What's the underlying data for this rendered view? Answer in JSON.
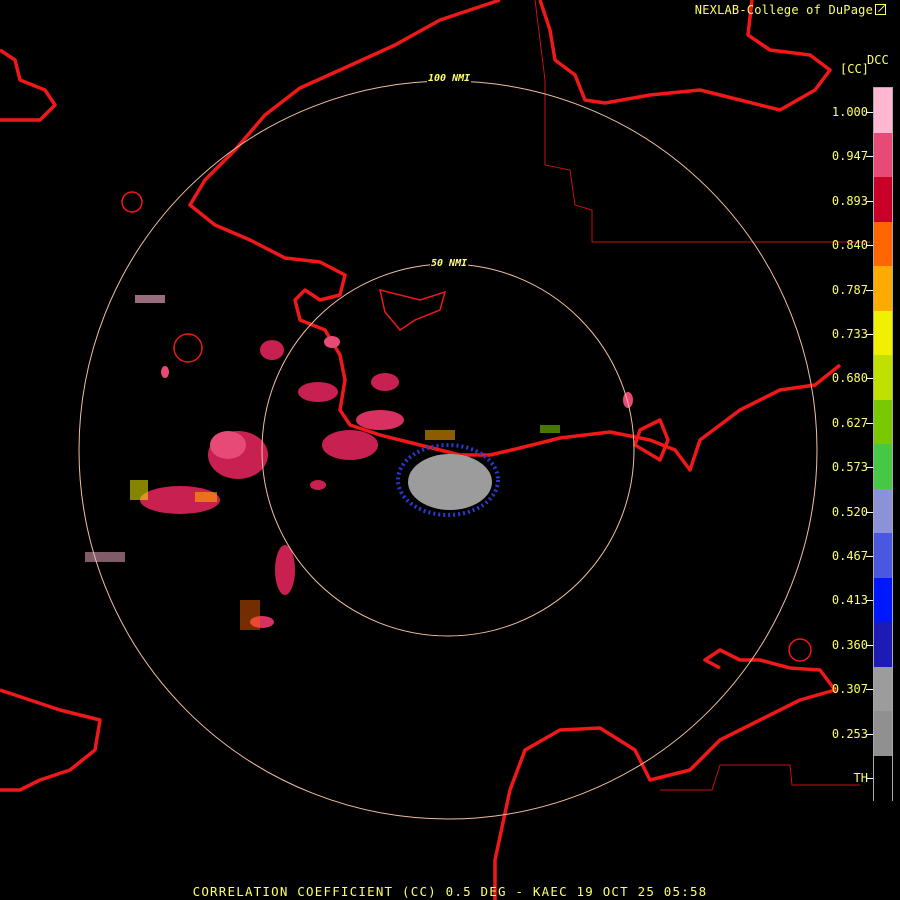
{
  "credit": "NEXLAB-College of DuPage",
  "product_code": "DCC",
  "unit_label": "[CC]",
  "caption": "CORRELATION COEFFICIENT (CC) 0.5 DEG - KAEC 19 OCT 25 05:58",
  "range_rings": [
    "100 NMI",
    "50 NMI"
  ],
  "color_scale": {
    "labels": [
      "1.000",
      "0.947",
      "0.893",
      "0.840",
      "0.787",
      "0.733",
      "0.680",
      "0.627",
      "0.573",
      "0.520",
      "0.467",
      "0.413",
      "0.360",
      "0.307",
      "0.253",
      "TH"
    ],
    "colors": [
      "#ffb6d0",
      "#e84a78",
      "#c80028",
      "#ff6600",
      "#ffaa00",
      "#f0f000",
      "#c0e000",
      "#7ac800",
      "#46c846",
      "#8c92d8",
      "#4a58e0",
      "#0018ff",
      "#1c1cb4",
      "#9c9c9c",
      "#909090",
      "#000000"
    ]
  },
  "icons": {
    "credit": "external-link-icon"
  }
}
